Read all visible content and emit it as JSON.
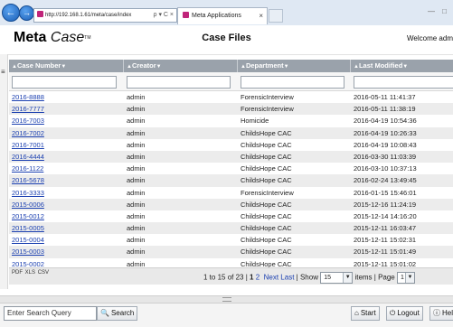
{
  "browser": {
    "back_icon": "back-arrow-icon",
    "forward_icon": "forward-arrow-icon",
    "address": "http://192.168.1.61/meta/case/index",
    "address_tools": "ρ ▾ C ×",
    "tab_title": "Meta Applications",
    "tab_close": "×",
    "window_controls": "— □"
  },
  "header": {
    "logo_meta": "Meta",
    "logo_case": "Case",
    "logo_tm": "TM",
    "title": "Case Files",
    "welcome": "Welcome adm"
  },
  "grid": {
    "columns": [
      {
        "label": "Case Number"
      },
      {
        "label": "Creator"
      },
      {
        "label": "Department"
      },
      {
        "label": "Last Modified"
      }
    ],
    "sort_up": "▲",
    "sort_down": "▼",
    "rows": [
      {
        "case": "2016-8888",
        "creator": "admin",
        "department": "ForensicInterview",
        "modified": "2016-05-11 11:41:37"
      },
      {
        "case": "2016-7777",
        "creator": "admin",
        "department": "ForensicInterview",
        "modified": "2016-05-11 11:38:19"
      },
      {
        "case": "2016-7003",
        "creator": "admin",
        "department": "Homicide",
        "modified": "2016-04-19 10:54:36"
      },
      {
        "case": "2016-7002",
        "creator": "admin",
        "department": "ChildsHope CAC",
        "modified": "2016-04-19 10:26:33"
      },
      {
        "case": "2016-7001",
        "creator": "admin",
        "department": "ChildsHope CAC",
        "modified": "2016-04-19 10:08:43"
      },
      {
        "case": "2016-4444",
        "creator": "admin",
        "department": "ChildsHope CAC",
        "modified": "2016-03-30 11:03:39"
      },
      {
        "case": "2016-1122",
        "creator": "admin",
        "department": "ChildsHope CAC",
        "modified": "2016-03-10 10:37:13"
      },
      {
        "case": "2016-5678",
        "creator": "admin",
        "department": "ChildsHope CAC",
        "modified": "2016-02-24 13:49:45"
      },
      {
        "case": "2016-3333",
        "creator": "admin",
        "department": "ForensicInterview",
        "modified": "2016-01-15 15:46:01"
      },
      {
        "case": "2015-0006",
        "creator": "admin",
        "department": "ChildsHope CAC",
        "modified": "2015-12-16 11:24:19"
      },
      {
        "case": "2015-0012",
        "creator": "admin",
        "department": "ChildsHope CAC",
        "modified": "2015-12-14 14:16:20"
      },
      {
        "case": "2015-0005",
        "creator": "admin",
        "department": "ChildsHope CAC",
        "modified": "2015-12-11 16:03:47"
      },
      {
        "case": "2015-0004",
        "creator": "admin",
        "department": "ChildsHope CAC",
        "modified": "2015-12-11 15:02:31"
      },
      {
        "case": "2015-0003",
        "creator": "admin",
        "department": "ChildsHope CAC",
        "modified": "2015-12-11 15:01:49"
      },
      {
        "case": "2015-0002",
        "creator": "admin",
        "department": "ChildsHope CAC",
        "modified": "2015-12-11 15:01:02"
      }
    ]
  },
  "pager": {
    "export_icons": [
      "pdf-icon",
      "xls-icon",
      "csv-icon"
    ],
    "export_labels": [
      "PDF",
      "XLS",
      "CSV"
    ],
    "range_text": "1 to 15 of 23 |",
    "page_current": "1",
    "page_other": "2",
    "next": "Next",
    "last": "Last",
    "show_label": "| Show",
    "show_value": "15",
    "items_label": "items | Page",
    "page_value": "1"
  },
  "footer": {
    "search_placeholder": "Enter Search Query",
    "search_button": "Search",
    "start_button": "Start",
    "logout_button": "Logout",
    "help_button": "Help"
  },
  "colors": {
    "grid_header": "#9aa2ab",
    "link": "#1a3fb0",
    "alt_row": "#ececec"
  }
}
